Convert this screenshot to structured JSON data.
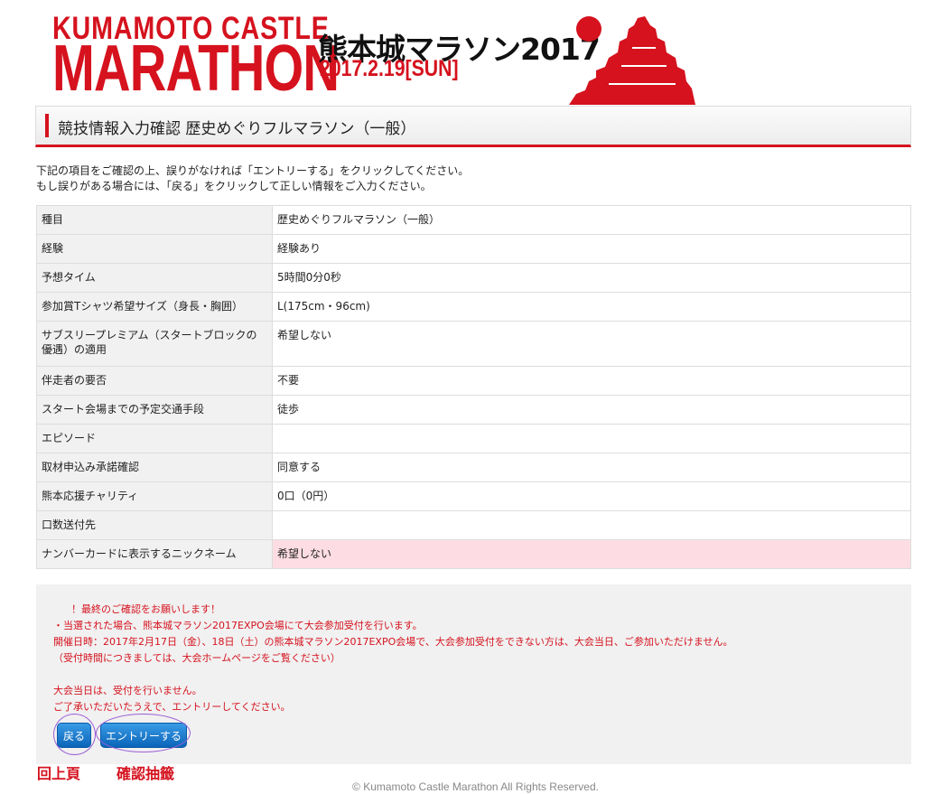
{
  "header": {
    "logo_line1": "KUMAMOTO CASTLE",
    "logo_line2": "MARATHON",
    "logo_jp": "熊本城マラソン2017",
    "logo_date": "2017.2.19[SUN]"
  },
  "page_title": "競技情報入力確認 歴史めぐりフルマラソン（一般）",
  "intro": [
    "下記の項目をご確認の上、誤りがなければ「エントリーする」をクリックしてください。",
    "もし誤りがある場合には、「戻る」をクリックして正しい情報をご入力ください。"
  ],
  "rows": [
    {
      "label": "種目",
      "value": "歴史めぐりフルマラソン（一般）"
    },
    {
      "label": "経験",
      "value": "経験あり"
    },
    {
      "label": "予想タイム",
      "value": "5時間0分0秒"
    },
    {
      "label": "参加賞Tシャツ希望サイズ（身長・胸囲）",
      "value": "L(175cm・96cm)"
    },
    {
      "label": "サブスリープレミアム（スタートブロックの優遇）の適用",
      "value": "希望しない"
    },
    {
      "label": "伴走者の要否",
      "value": "不要"
    },
    {
      "label": "スタート会場までの予定交通手段",
      "value": "徒歩"
    },
    {
      "label": "エピソード",
      "value": ""
    },
    {
      "label": "取材申込み承諾確認",
      "value": "同意する"
    },
    {
      "label": "熊本応援チャリティ",
      "value": "0口（0円）"
    },
    {
      "label": "口数送付先",
      "value": ""
    },
    {
      "label": "ナンバーカードに表示するニックネーム",
      "value": "希望しない"
    }
  ],
  "notice": {
    "line1": "！最終のご確認をお願いします！",
    "line2": "・当選された場合、熊本城マラソン2017EXPO会場にて大会参加受付を行います。",
    "line3": "開催日時：2017年2月17日（金）、18日（土）の熊本城マラソン2017EXPO会場で、大会参加受付をできない方は、大会当日、ご参加いただけません。",
    "line4": "（受付時間につきましては、大会ホームページをご覧ください）",
    "line5": "大会当日は、受付を行いません。",
    "line6": "ご了承いただいたうえで、エントリーしてください。"
  },
  "buttons": {
    "back": "戻る",
    "entry": "エントリーする"
  },
  "annotations": {
    "back": "回上頁",
    "entry": "確認抽籤"
  },
  "footer": "© Kumamoto Castle Marathon All Rights Reserved.",
  "colors": {
    "brand_red": "#d5121e",
    "button_blue": "#0a64b8",
    "highlight_pink": "#fddde3",
    "annotation_purple": "#9b5fd6"
  }
}
